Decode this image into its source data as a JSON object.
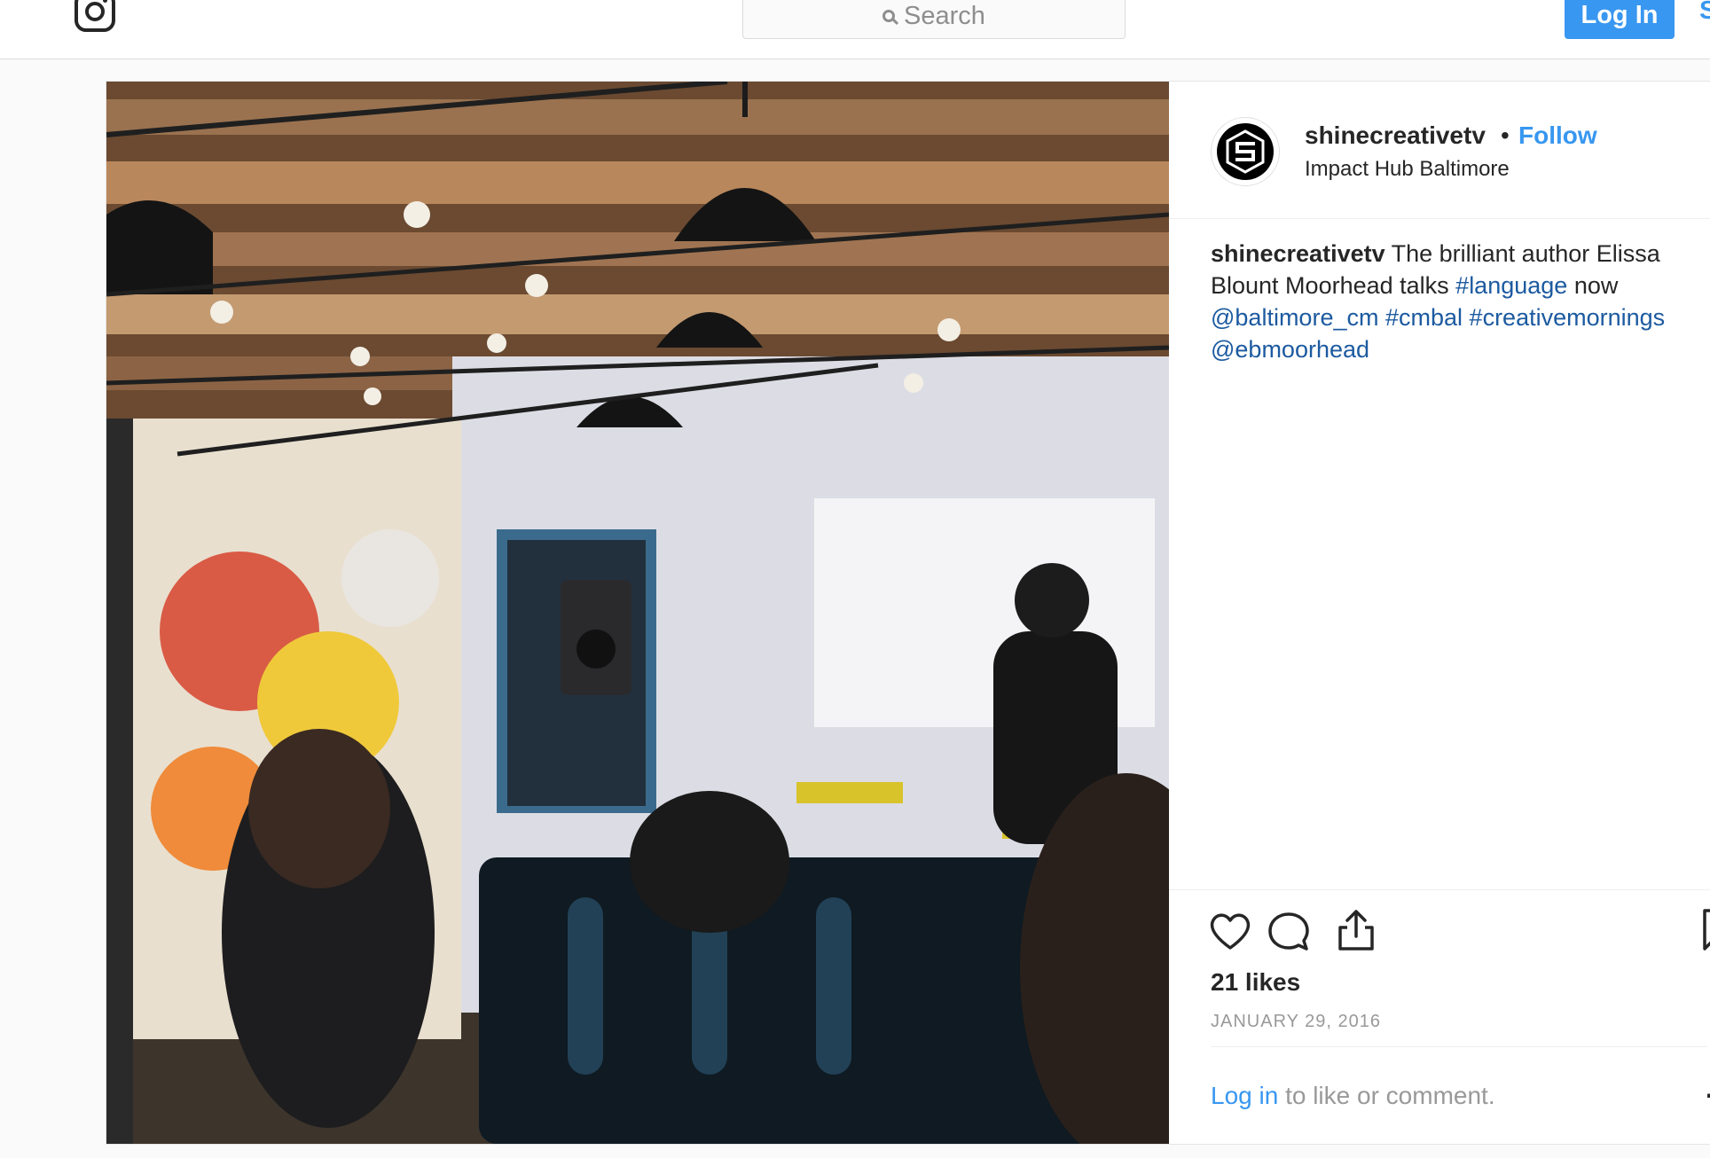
{
  "header": {
    "search_placeholder": "Search",
    "login_label": "Log In",
    "signup_peek": "S"
  },
  "post": {
    "username": "shinecreativetv",
    "separator": "•",
    "follow_label": "Follow",
    "location": "Impact Hub Baltimore",
    "caption": {
      "author": "shinecreativetv",
      "text": " The brilliant author Elissa Blount Moorhead talks ",
      "tag_language": "#language",
      "text_now": " now ",
      "mention_baltimore": "@baltimore_cm",
      "tag_cmbal": "#cmbal",
      "tag_creativemornings": "#creativemornings",
      "mention_ebmoorhead": "@ebmoorhead"
    },
    "likes": "21 likes",
    "date": "JANUARY 29, 2016",
    "comment_login": "Log in",
    "comment_rest": " to like or comment.",
    "more": "..."
  },
  "icons": {
    "logo": "instagram-icon",
    "search": "search-icon",
    "like": "heart-icon",
    "comment": "comment-icon",
    "share": "share-icon",
    "save": "bookmark-icon",
    "more": "more-options-icon"
  },
  "colors": {
    "accent": "#3897f0",
    "text": "#262626",
    "muted": "#999999",
    "link": "#1c5aa0",
    "border": "#dbdbdb",
    "background": "#fafafa"
  }
}
